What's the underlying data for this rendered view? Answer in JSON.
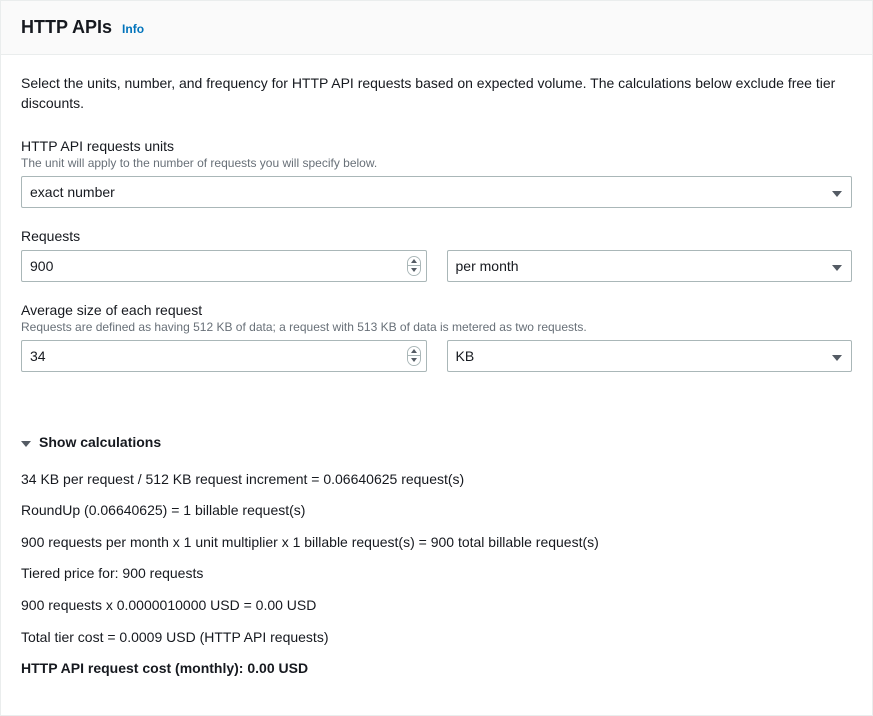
{
  "header": {
    "title": "HTTP APIs",
    "info_link": "Info"
  },
  "description": "Select the units, number, and frequency for HTTP API requests based on expected volume. The calculations below exclude free tier discounts.",
  "units_field": {
    "label": "HTTP API requests units",
    "hint": "The unit will apply to the number of requests you will specify below.",
    "value": "exact number"
  },
  "requests_field": {
    "label": "Requests",
    "number_value": "900",
    "frequency_value": "per month"
  },
  "avg_size_field": {
    "label": "Average size of each request",
    "hint": "Requests are defined as having 512 KB of data; a request with 513 KB of data is metered as two requests.",
    "number_value": "34",
    "unit_value": "KB"
  },
  "calculations": {
    "toggle_label": "Show calculations",
    "lines": {
      "l1": "34 KB per request / 512 KB request increment = 0.06640625 request(s)",
      "l2": "RoundUp (0.06640625) = 1 billable request(s)",
      "l3": "900 requests per month x 1 unit multiplier x 1 billable request(s) = 900 total billable request(s)",
      "l4": "Tiered price for: 900 requests",
      "l5": "900 requests x 0.0000010000 USD = 0.00 USD",
      "l6": "Total tier cost = 0.0009 USD (HTTP API requests)",
      "total": "HTTP API request cost (monthly): 0.00 USD"
    }
  },
  "chart_data": {
    "type": "table",
    "title": "HTTP API request cost calculation",
    "inputs": {
      "requests_per_month": 900,
      "avg_size_kb": 34,
      "request_increment_kb": 512,
      "price_per_request_usd": 1e-06
    },
    "derived": {
      "raw_requests_per_item": 0.06640625,
      "billable_requests_per_item": 1,
      "total_billable_requests": 900,
      "total_tier_cost_usd": 0.0009,
      "monthly_cost_usd_rounded": 0.0
    }
  }
}
